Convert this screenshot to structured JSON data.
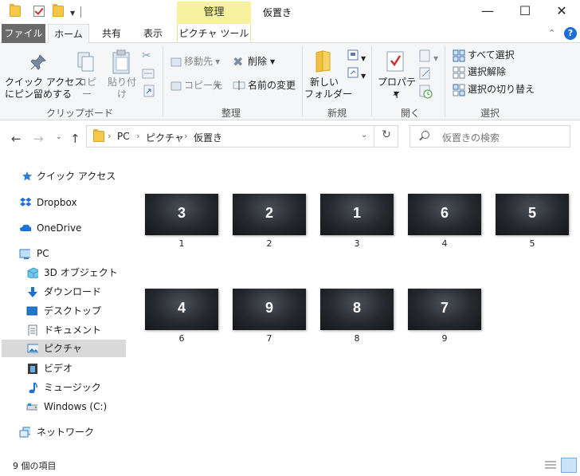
{
  "window": {
    "title": "仮置き",
    "context_tab": "管理"
  },
  "ribbon_tabs": {
    "file": "ファイル",
    "home": "ホーム",
    "share": "共有",
    "view": "表示",
    "picture_tools": "ピクチャ ツール"
  },
  "ribbon": {
    "clipboard": {
      "pin_quick_access": "クイック アクセス\nにピン留めする",
      "copy": "コピー",
      "paste": "貼り付け",
      "group_label": "クリップボード"
    },
    "organize": {
      "move_to": "移動先",
      "copy_to": "コピー先",
      "delete": "削除",
      "rename": "名前の変更",
      "group_label": "整理"
    },
    "new": {
      "new_folder": "新しい\nフォルダー",
      "group_label": "新規"
    },
    "open": {
      "properties": "プロパティ",
      "group_label": "開く"
    },
    "select": {
      "select_all": "すべて選択",
      "select_none": "選択解除",
      "invert_selection": "選択の切り替え",
      "group_label": "選択"
    }
  },
  "address": {
    "crumbs": [
      "PC",
      "ピクチャ",
      "仮置き"
    ],
    "search_placeholder": "仮置きの検索"
  },
  "nav": {
    "items": [
      {
        "label": "クイック アクセス",
        "icon": "star-icon"
      },
      {
        "label": "Dropbox",
        "icon": "dropbox-icon"
      },
      {
        "label": "OneDrive",
        "icon": "cloud-icon"
      },
      {
        "label": "PC",
        "icon": "pc-icon"
      },
      {
        "label": "3D オブジェクト",
        "icon": "cube-icon"
      },
      {
        "label": "ダウンロード",
        "icon": "download-icon"
      },
      {
        "label": "デスクトップ",
        "icon": "desktop-icon"
      },
      {
        "label": "ドキュメント",
        "icon": "document-icon"
      },
      {
        "label": "ピクチャ",
        "icon": "pictures-icon",
        "selected": true
      },
      {
        "label": "ビデオ",
        "icon": "video-icon"
      },
      {
        "label": "ミュージック",
        "icon": "music-icon"
      },
      {
        "label": "Windows (C:)",
        "icon": "drive-icon"
      },
      {
        "label": "ネットワーク",
        "icon": "network-icon"
      }
    ]
  },
  "files": [
    {
      "image_text": "3",
      "name": "1"
    },
    {
      "image_text": "2",
      "name": "2"
    },
    {
      "image_text": "1",
      "name": "3"
    },
    {
      "image_text": "6",
      "name": "4"
    },
    {
      "image_text": "5",
      "name": "5"
    },
    {
      "image_text": "4",
      "name": "6"
    },
    {
      "image_text": "9",
      "name": "7"
    },
    {
      "image_text": "8",
      "name": "8"
    },
    {
      "image_text": "7",
      "name": "9"
    }
  ],
  "status": {
    "item_count": "9 個の項目"
  }
}
